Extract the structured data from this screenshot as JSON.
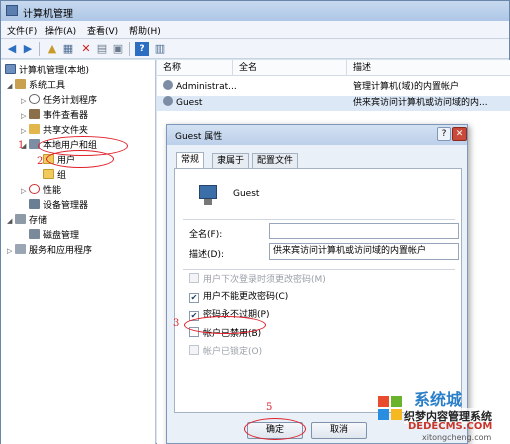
{
  "window": {
    "title": "计算机管理"
  },
  "menu": [
    "文件(F)",
    "操作(A)",
    "查看(V)",
    "帮助(H)"
  ],
  "toolbar_icons": [
    "back-icon",
    "forward-icon",
    "up-folder-icon",
    "show-hide-tree-icon",
    "delete-icon",
    "properties-icon",
    "export-icon",
    "help-icon",
    "console-icon"
  ],
  "tree": {
    "root": "计算机管理(本地)",
    "system_tools": "系统工具",
    "task_scheduler": "任务计划程序",
    "event_viewer": "事件查看器",
    "shared_folders": "共享文件夹",
    "local_users_groups": "本地用户和组",
    "users": "用户",
    "groups": "组",
    "performance": "性能",
    "device_manager": "设备管理器",
    "storage": "存储",
    "disk_management": "磁盘管理",
    "services_apps": "服务和应用程序"
  },
  "list": {
    "columns": [
      "名称",
      "全名",
      "描述"
    ],
    "rows": [
      {
        "name": "Administrat...",
        "fullname": "",
        "desc": "管理计算机(域)的内置帐户"
      },
      {
        "name": "Guest",
        "fullname": "",
        "desc": "供来宾访问计算机或访问域的内..."
      }
    ]
  },
  "dialog": {
    "title": "Guest 属性",
    "help_label": "?",
    "close_label": "✕",
    "tabs": [
      "常规",
      "隶属于",
      "配置文件"
    ],
    "username": "Guest",
    "fullname_label": "全名(F):",
    "fullname_value": "",
    "desc_label": "描述(D):",
    "desc_value": "供来宾访问计算机或访问域的内置帐户",
    "checkboxes": [
      {
        "label": "用户下次登录时须更改密码(M)",
        "checked": false,
        "disabled": true
      },
      {
        "label": "用户不能更改密码(C)",
        "checked": true,
        "disabled": false
      },
      {
        "label": "密码永不过期(P)",
        "checked": true,
        "disabled": false
      },
      {
        "label": "帐户已禁用(B)",
        "checked": false,
        "disabled": false
      },
      {
        "label": "帐户已锁定(O)",
        "checked": false,
        "disabled": true
      }
    ],
    "ok_label": "确定",
    "cancel_label": "取消"
  },
  "annotations": [
    "1",
    "2",
    "3",
    "5"
  ],
  "watermark": {
    "line1": "系统城",
    "line2": "织梦内容管理系统",
    "line3": "DEDECMS.COM",
    "line4": "xitongcheng.com"
  },
  "colors": {
    "annotation": "#e0202a",
    "selection": "#dde8f6"
  }
}
